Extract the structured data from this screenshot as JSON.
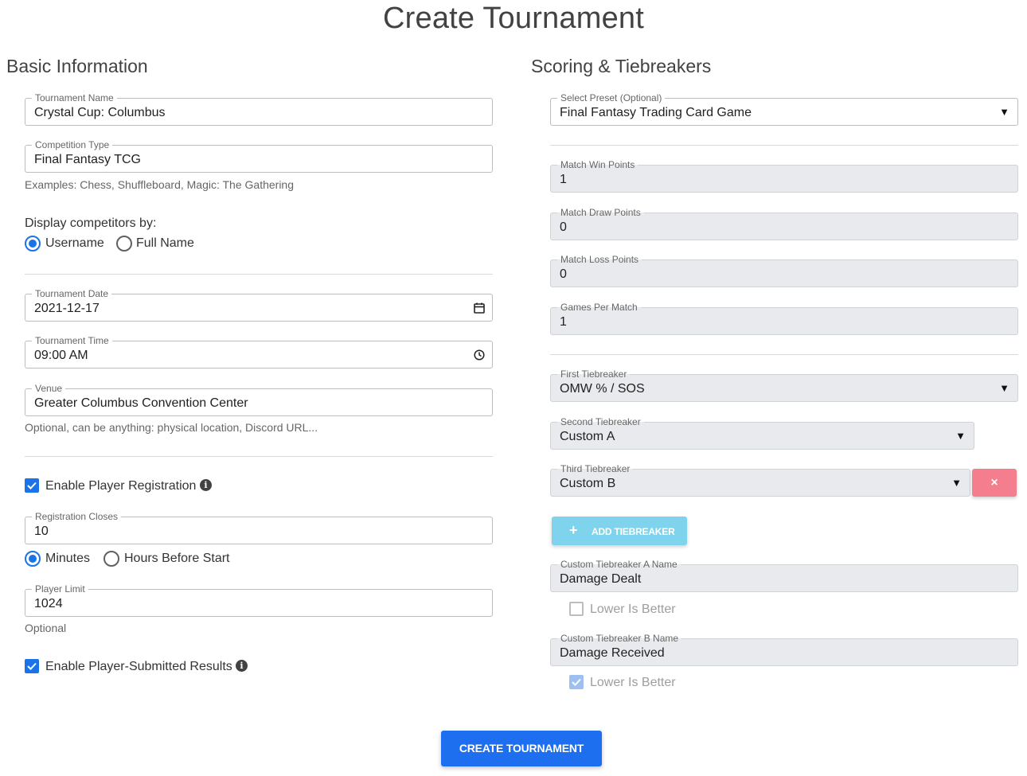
{
  "page": {
    "title": "Create Tournament"
  },
  "basic": {
    "heading": "Basic Information",
    "tournament_name": {
      "label": "Tournament Name",
      "value": "Crystal Cup: Columbus"
    },
    "competition_type": {
      "label": "Competition Type",
      "value": "Final Fantasy TCG",
      "hint": "Examples: Chess, Shuffleboard, Magic: The Gathering"
    },
    "display_by": {
      "label": "Display competitors by:",
      "options": [
        "Username",
        "Full Name"
      ],
      "selected": "Username"
    },
    "date": {
      "label": "Tournament Date",
      "value": "2021-12-17",
      "icon": "calendar-icon"
    },
    "time": {
      "label": "Tournament Time",
      "value": "09:00 AM",
      "icon": "clock-icon"
    },
    "venue": {
      "label": "Venue",
      "value": "Greater Columbus Convention Center",
      "hint": "Optional, can be anything: physical location, Discord URL..."
    },
    "enable_registration": {
      "label": "Enable Player Registration",
      "checked": true
    },
    "registration_closes": {
      "label": "Registration Closes",
      "value": "10",
      "options": [
        "Minutes",
        "Hours Before Start"
      ],
      "selected": "Minutes"
    },
    "player_limit": {
      "label": "Player Limit",
      "value": "1024",
      "hint": "Optional"
    },
    "enable_results": {
      "label": "Enable Player-Submitted Results",
      "checked": true
    }
  },
  "scoring": {
    "heading": "Scoring & Tiebreakers",
    "preset": {
      "label": "Select Preset (Optional)",
      "value": "Final Fantasy Trading Card Game"
    },
    "match_win": {
      "label": "Match Win Points",
      "value": "1"
    },
    "match_draw": {
      "label": "Match Draw Points",
      "value": "0"
    },
    "match_loss": {
      "label": "Match Loss Points",
      "value": "0"
    },
    "games_per_match": {
      "label": "Games Per Match",
      "value": "1"
    },
    "first_tiebreaker": {
      "label": "First Tiebreaker",
      "value": "OMW % / SOS"
    },
    "second_tiebreaker": {
      "label": "Second Tiebreaker",
      "value": "Custom A"
    },
    "third_tiebreaker": {
      "label": "Third Tiebreaker",
      "value": "Custom B"
    },
    "remove_label": "×",
    "add_tiebreaker_label": "ADD TIEBREAKER",
    "custom_a": {
      "label": "Custom Tiebreaker A Name",
      "value": "Damage Dealt",
      "lower_label": "Lower Is Better",
      "lower_checked": false
    },
    "custom_b": {
      "label": "Custom Tiebreaker B Name",
      "value": "Damage Received",
      "lower_label": "Lower Is Better",
      "lower_checked": true
    }
  },
  "actions": {
    "create_label": "CREATE TOURNAMENT"
  },
  "colors": {
    "primary": "#1e6ff0",
    "danger": "#f47e8e",
    "info": "#7fd3ec"
  }
}
